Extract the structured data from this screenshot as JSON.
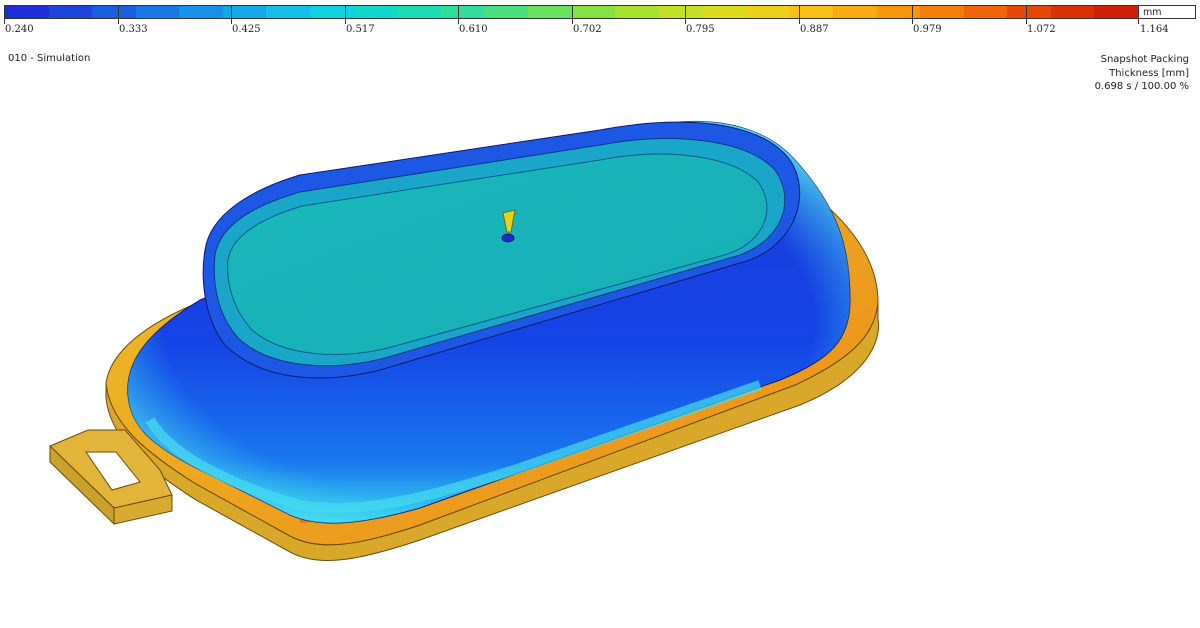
{
  "legend": {
    "unit": "mm",
    "ticks": [
      "0.240",
      "0.333",
      "0.425",
      "0.517",
      "0.610",
      "0.702",
      "0.795",
      "0.887",
      "0.979",
      "1.072",
      "1.164"
    ],
    "colors": [
      "#1f2fd8",
      "#1d45dc",
      "#1a5fe0",
      "#1877e4",
      "#1690e8",
      "#14a8ea",
      "#12c0ea",
      "#10d2e0",
      "#12d8cc",
      "#1cdcb4",
      "#2ede9a",
      "#48e07e",
      "#66e260",
      "#86e244",
      "#a6e230",
      "#c4e024",
      "#dcda1c",
      "#eed018",
      "#f6c014",
      "#f8ac10",
      "#f8960c",
      "#f47e0a",
      "#ee6408",
      "#e44a06",
      "#da3206",
      "#d01e08"
    ]
  },
  "simulation": {
    "title": "010 - Simulation"
  },
  "result": {
    "name": "Snapshot Packing",
    "quantity": "Thickness [mm]",
    "time": "0.698 s  /  100.00 %"
  }
}
